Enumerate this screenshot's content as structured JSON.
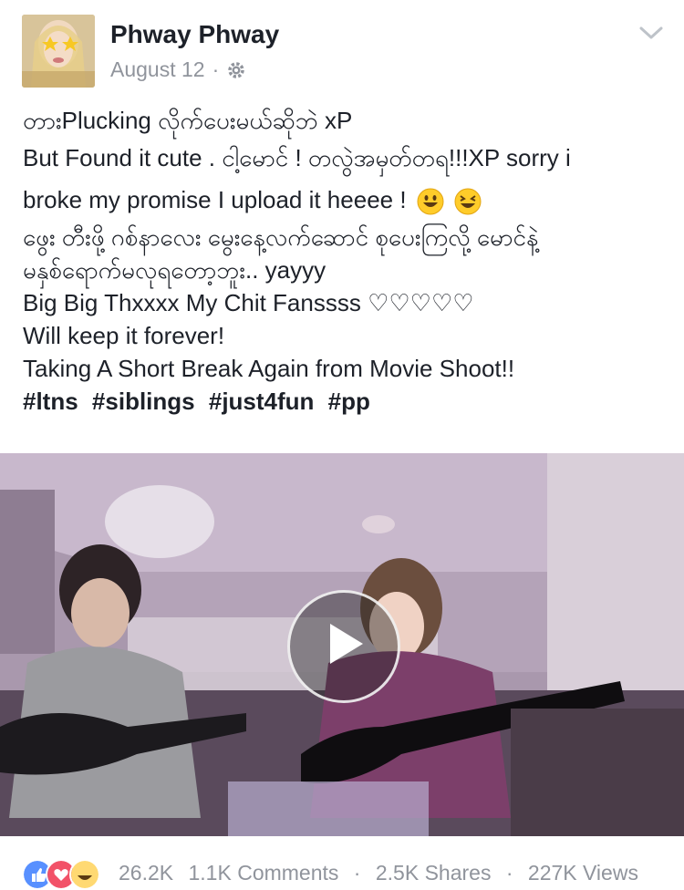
{
  "post": {
    "author": "Phway Phway",
    "date": "August 12",
    "separator": "·",
    "privacy_icon": "gear-icon",
    "menu_icon": "chevron-down-icon",
    "text_lines": [
      "တားPlucking လိုက်ပေးမယ်ဆိုဘဲ xP",
      "But Found it cute . ငါ့မောင် ! တလွဲအမှတ်တရ!!!XP sorry i",
      "broke my promise I upload it heeee !",
      "ဖွေး တီးဖို့ ဂစ်နာလေး မွေးနေ့လက်ဆောင် စုပေးကြလို့ မောင်နဲ့",
      "မနှစ်ရောက်မလုရတော့ဘူး.. yayyy",
      "Big Big Thxxxx My Chit Fanssss ♡♡♡♡♡",
      "Will keep it forever!",
      "Taking A Short Break Again from Movie Shoot!!"
    ],
    "hashtags": [
      "#ltns",
      "#siblings",
      "#just4fun",
      "#pp"
    ]
  },
  "footer": {
    "reaction_count": "26.2K",
    "comments": "1.1K Comments",
    "shares": "2.5K Shares",
    "views": "227K Views",
    "dot": "·"
  },
  "colors": {
    "text": "#1d2129",
    "meta": "#90949c",
    "like_blue": "#5890ff",
    "love_red": "#f25268",
    "haha_yellow": "#ffd972"
  }
}
